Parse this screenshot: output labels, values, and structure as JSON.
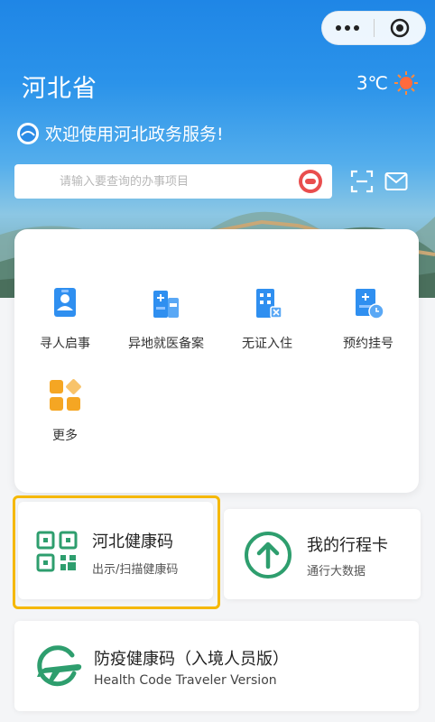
{
  "header": {
    "province": "河北省",
    "temperature": "3℃",
    "welcome": "欢迎使用河北政务服务!"
  },
  "search": {
    "placeholder": "请输入要查询的办事项目"
  },
  "services": [
    {
      "label": "寻人启事",
      "icon": "person-search-icon"
    },
    {
      "label": "异地就医备案",
      "icon": "hospital-record-icon"
    },
    {
      "label": "无证入住",
      "icon": "hotel-checkin-icon"
    },
    {
      "label": "预约挂号",
      "icon": "appointment-icon"
    },
    {
      "label": "更多",
      "icon": "more-grid-icon"
    }
  ],
  "tiles": {
    "health_code": {
      "title": "河北健康码",
      "subtitle": "出示/扫描健康码",
      "icon": "qr-code-icon"
    },
    "itinerary": {
      "title": "我的行程卡",
      "subtitle": "通行大数据",
      "icon": "arrow-up-circle-icon"
    },
    "traveler": {
      "title": "防疫健康码（入境人员版）",
      "subtitle": "Health Code Traveler Version",
      "icon": "airplane-icon"
    }
  },
  "colors": {
    "primary_blue": "#1f86e6",
    "green": "#2e9e6e",
    "highlight": "#f5b800",
    "orange": "#f5a623"
  }
}
